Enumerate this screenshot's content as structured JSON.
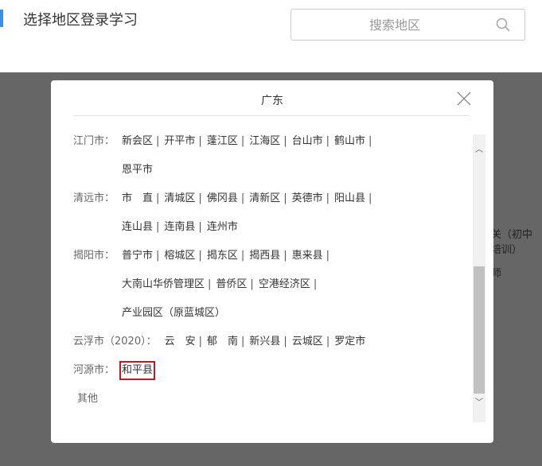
{
  "header": {
    "title": "选择地区登录学习",
    "search_placeholder": "搜索地区"
  },
  "background": {
    "snippets": [
      "乐关（初中",
      "络培训）",
      "计师"
    ]
  },
  "modal": {
    "title": "广东",
    "rows": [
      {
        "label": "江门市：",
        "items": [
          "新会区",
          "开平市",
          "蓬江区",
          "江海区",
          "台山市",
          "鹤山市"
        ],
        "trail": true
      },
      {
        "label": "",
        "items": [
          "恩平市"
        ],
        "trail": false
      },
      {
        "label": "清远市：",
        "items": [
          "市　直",
          "清城区",
          "佛冈县",
          "清新区",
          "英德市",
          "阳山县"
        ],
        "trail": true
      },
      {
        "label": "",
        "items": [
          "连山县",
          "连南县",
          "连州市"
        ],
        "trail": false
      },
      {
        "label": "揭阳市：",
        "items": [
          "普宁市",
          "榕城区",
          "揭东区",
          "揭西县",
          "惠来县"
        ],
        "trail": true
      },
      {
        "label": "",
        "items": [
          "大南山华侨管理区",
          "普侨区",
          "空港经济区"
        ],
        "trail": true
      },
      {
        "label": "",
        "items": [
          "产业园区（原蓝城区）"
        ],
        "trail": false
      },
      {
        "label": "云浮市（2020）：",
        "items": [
          "云　安",
          "郁　南",
          "新兴县",
          "云城区",
          "罗定市"
        ],
        "trail": false
      },
      {
        "label": "河源市：",
        "items": [
          "和平县"
        ],
        "trail": false,
        "selected": 0
      },
      {
        "label": "其他",
        "items": [],
        "trail": false
      }
    ]
  },
  "colors": {
    "accent": "#3a8ee6",
    "selected_border": "#c8161d",
    "overlay": "#666666"
  }
}
